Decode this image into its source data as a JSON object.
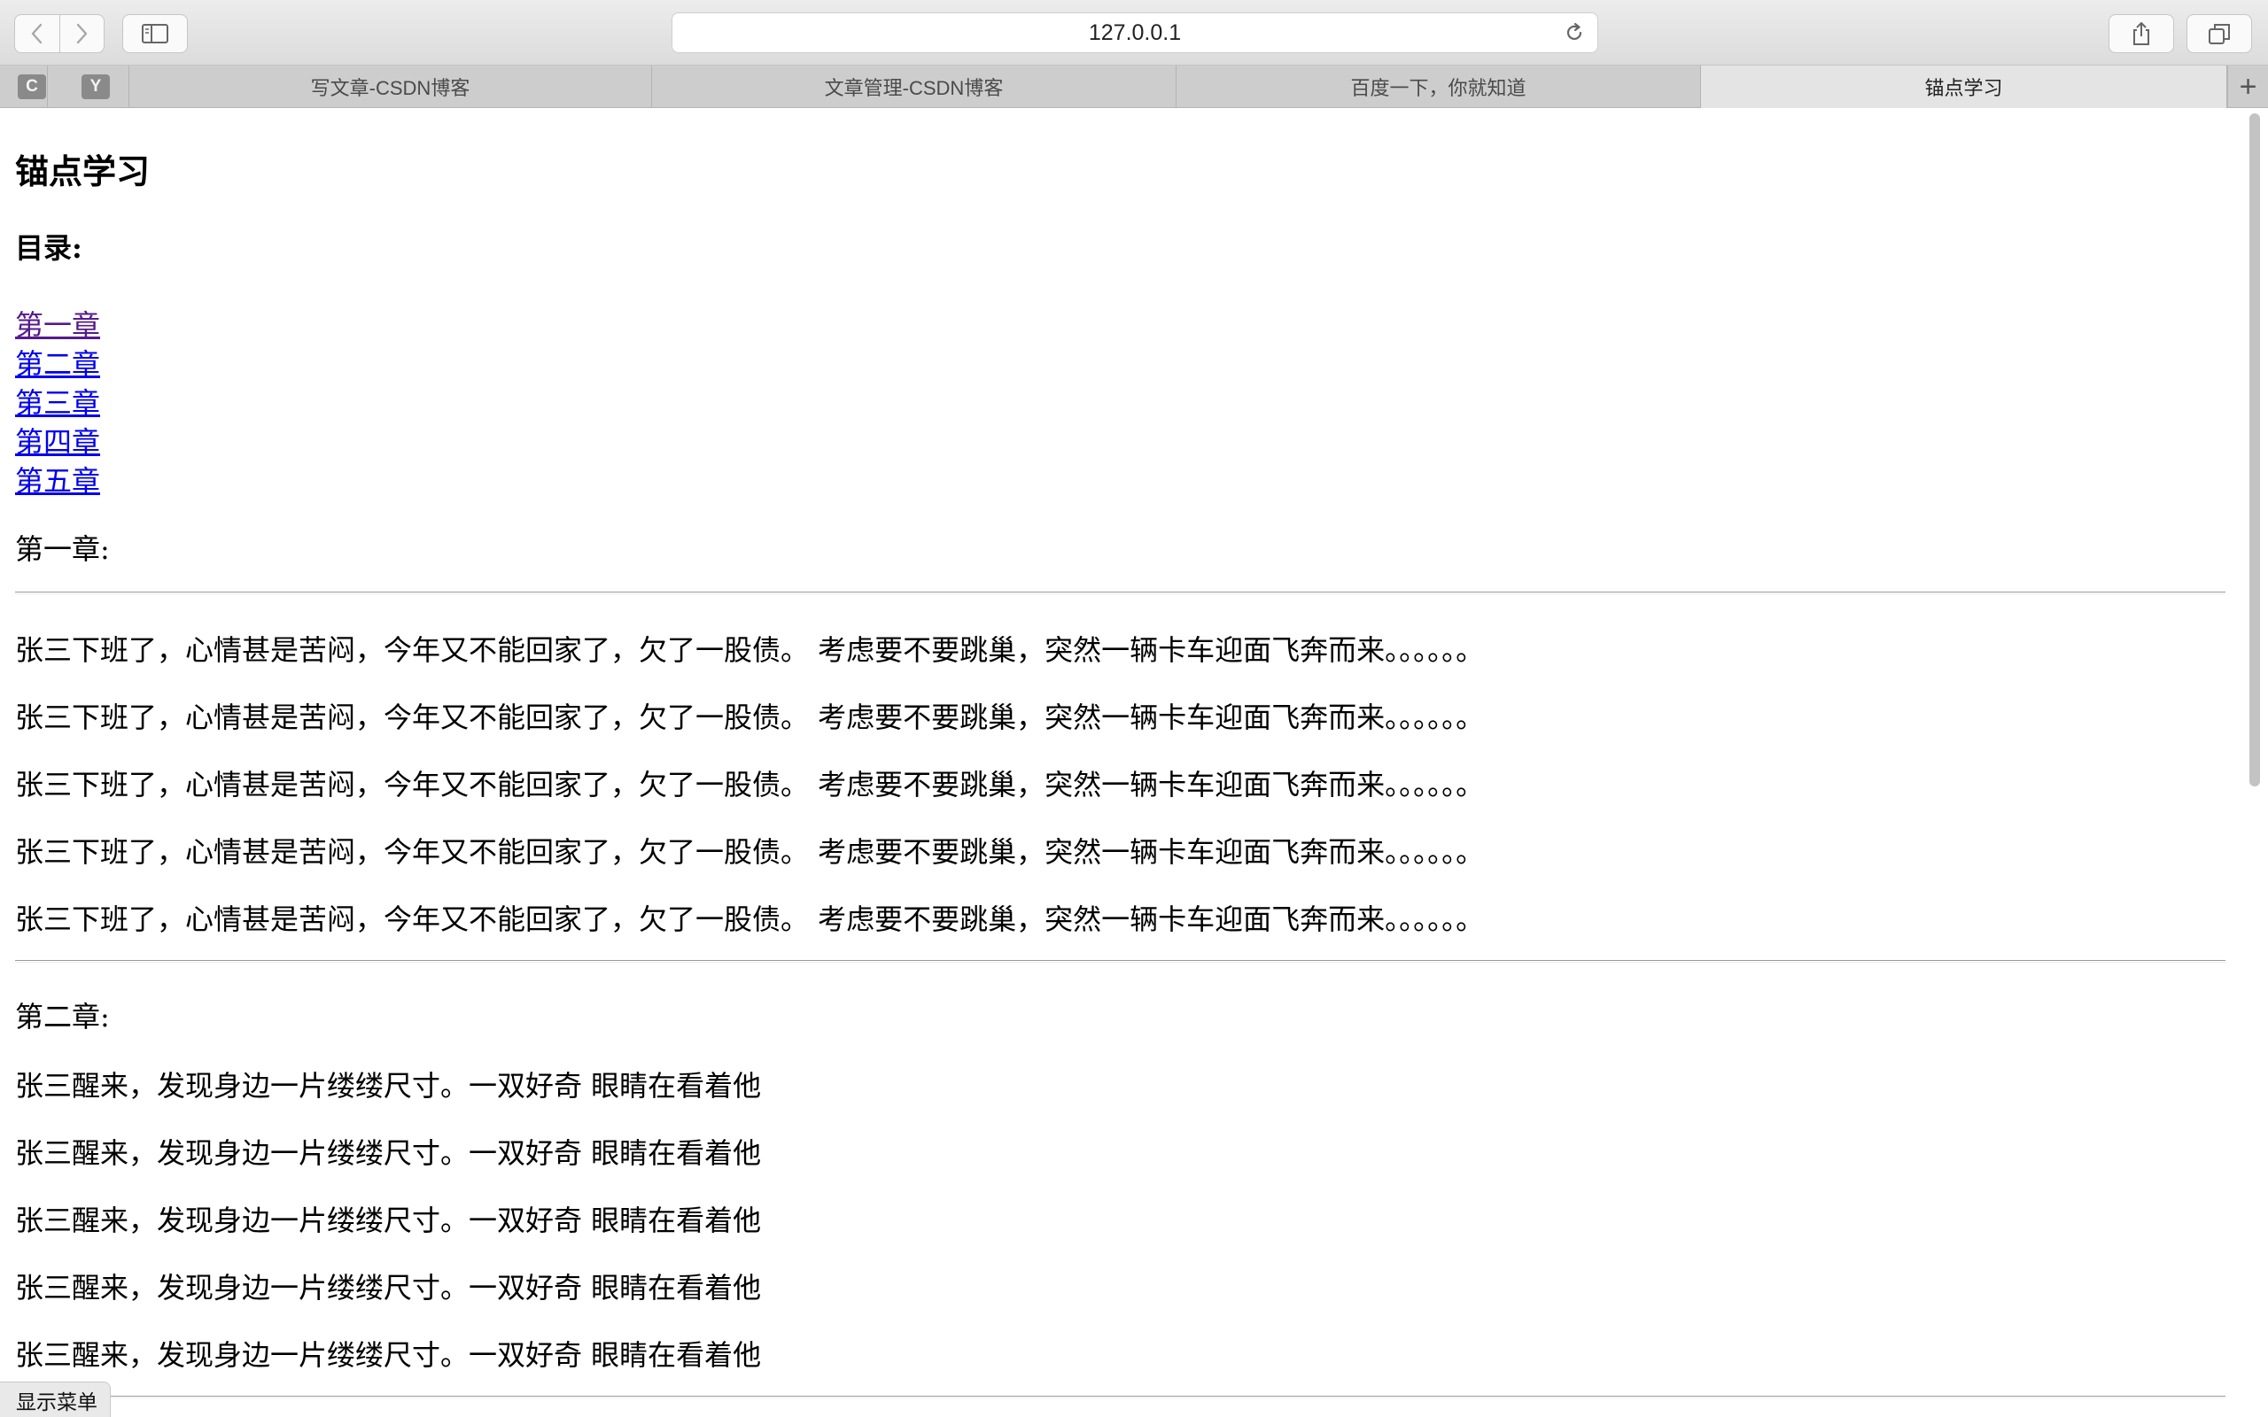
{
  "browser": {
    "url": "127.0.0.1",
    "favicons": [
      "C",
      "Y"
    ],
    "tabs": [
      {
        "label": "写文章-CSDN博客",
        "active": false
      },
      {
        "label": "文章管理-CSDN博客",
        "active": false
      },
      {
        "label": "百度一下，你就知道",
        "active": false
      },
      {
        "label": "锚点学习",
        "active": true
      }
    ],
    "new_tab_glyph": "+"
  },
  "page": {
    "title": "锚点学习",
    "toc_heading": "目录:",
    "toc": [
      "第一章",
      "第二章",
      "第三章",
      "第四章",
      "第五章"
    ],
    "chapter1": {
      "heading": "第一章:",
      "lines": [
        "张三下班了，心情甚是苦闷，今年又不能回家了，欠了一股债。 考虑要不要跳巢，突然一辆卡车迎面飞奔而来。。。。。。",
        "张三下班了，心情甚是苦闷，今年又不能回家了，欠了一股债。 考虑要不要跳巢，突然一辆卡车迎面飞奔而来。。。。。。",
        "张三下班了，心情甚是苦闷，今年又不能回家了，欠了一股债。 考虑要不要跳巢，突然一辆卡车迎面飞奔而来。。。。。。",
        "张三下班了，心情甚是苦闷，今年又不能回家了，欠了一股债。 考虑要不要跳巢，突然一辆卡车迎面飞奔而来。。。。。。",
        "张三下班了，心情甚是苦闷，今年又不能回家了，欠了一股债。 考虑要不要跳巢，突然一辆卡车迎面飞奔而来。。。。。。"
      ]
    },
    "chapter2": {
      "heading": "第二章:",
      "lines": [
        "张三醒来，发现身边一片缕缕尺寸。一双好奇 眼睛在看着他",
        "张三醒来，发现身边一片缕缕尺寸。一双好奇 眼睛在看着他",
        "张三醒来，发现身边一片缕缕尺寸。一双好奇 眼睛在看着他",
        "张三醒来，发现身边一片缕缕尺寸。一双好奇 眼睛在看着他",
        "张三醒来，发现身边一片缕缕尺寸。一双好奇 眼睛在看着他"
      ]
    },
    "menu_button": "显示菜单"
  },
  "colors": {
    "link": "#0000ee",
    "link_visited": "#551a8b",
    "toolbar_bg": "#dcdcdc",
    "tabbar_bg": "#cdcdcd",
    "active_tab_bg": "#e4e4e4"
  },
  "icons": [
    "back-icon",
    "forward-icon",
    "sidebar-icon",
    "reload-icon",
    "share-icon",
    "tabs-overview-icon"
  ]
}
